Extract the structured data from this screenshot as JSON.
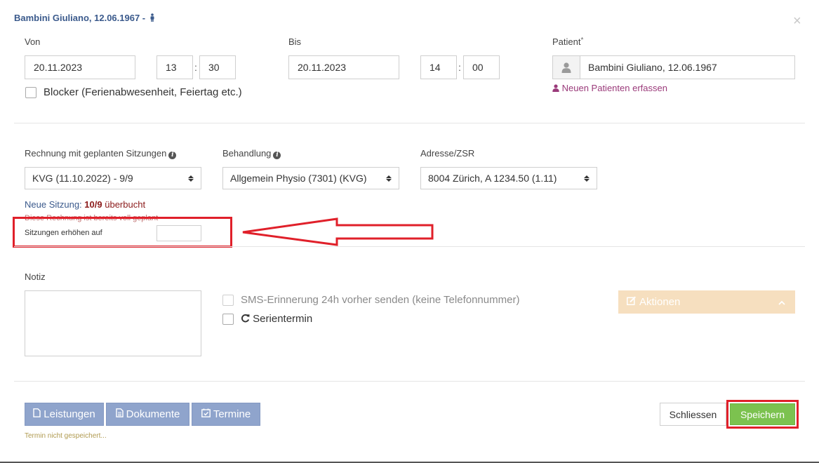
{
  "header": {
    "title": "Bambini Giuliano, 12.06.1967 -",
    "close_label": "×"
  },
  "time": {
    "from_label": "Von",
    "from_date": "20.11.2023",
    "from_hour": "13",
    "from_minute": "30",
    "to_label": "Bis",
    "to_date": "20.11.2023",
    "to_hour": "14",
    "to_minute": "00",
    "separator": ":"
  },
  "blocker": {
    "label": "Blocker (Ferienabwesenheit, Feiertag etc.)"
  },
  "patient": {
    "label": "Patient",
    "required_mark": "*",
    "value": "Bambini Giuliano, 12.06.1967",
    "new_patient_link": "Neuen Patienten erfassen"
  },
  "billing": {
    "invoice_label": "Rechnung mit geplanten Sitzungen",
    "invoice_value": "KVG (11.10.2022) - 9/9",
    "treatment_label": "Behandlung",
    "treatment_value": "Allgemein Physio (7301) (KVG)",
    "address_label": "Adresse/ZSR",
    "address_value": "8004 Zürich, A 1234.50 (1.11)",
    "info_glyph": "i"
  },
  "session": {
    "new_session_prefix": "Neue Sitzung:",
    "count": "10/9",
    "overbooked": "überbucht",
    "already_planned_note": "Diese Rechnung ist bereits voll geplant",
    "increase_label": "Sitzungen erhöhen auf",
    "increase_value": ""
  },
  "notes": {
    "label": "Notiz",
    "value": ""
  },
  "options": {
    "sms_label": "SMS-Erinnerung 24h vorher senden (keine Telefonnummer)",
    "series_label": "Serientermin"
  },
  "actions": {
    "label": "Aktionen"
  },
  "footer": {
    "services_button": "Leistungen",
    "documents_button": "Dokumente",
    "appointments_button": "Termine",
    "status_text": "Termin nicht gespeichert...",
    "close_button": "Schliessen",
    "save_button": "Speichern"
  },
  "colors": {
    "accent_blue": "#3b5a8c",
    "highlight_red": "#e0202a",
    "save_green": "#7cc24f",
    "footer_button": "#8fa4cc",
    "actions_disabled": "#f6dfbf"
  }
}
